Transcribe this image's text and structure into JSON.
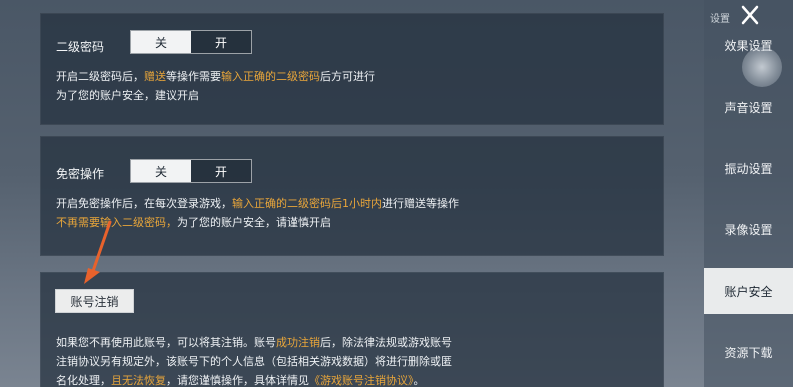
{
  "sidebar": {
    "header": "设置",
    "items": [
      {
        "label": "效果设置"
      },
      {
        "label": "声音设置"
      },
      {
        "label": "振动设置"
      },
      {
        "label": "录像设置"
      },
      {
        "label": "账户安全",
        "active": true
      },
      {
        "label": "资源下载"
      }
    ]
  },
  "secondary_password": {
    "label": "二级密码",
    "toggle": {
      "off": "关",
      "on": "开",
      "selected": "关"
    },
    "desc": {
      "l1_a": "开启二级密码后，",
      "l1_b": "赠送",
      "l1_c": "等操作需要",
      "l1_d": "输入正确的二级密码",
      "l1_e": "后方可进行",
      "l2": "为了您的账户安全，建议开启"
    }
  },
  "password_free": {
    "label": "免密操作",
    "toggle": {
      "off": "关",
      "on": "开",
      "selected": "关"
    },
    "desc": {
      "l1_a": "开启免密操作后，在每次登录游戏，",
      "l1_b": "输入正确的二级密码后1小时内",
      "l1_c": "进行赠送等操作",
      "l2_a": "不再需要输入二级密码，",
      "l2_b": "为了您的账户安全，请谨慎开启"
    }
  },
  "account_cancel": {
    "button": "账号注销",
    "desc": {
      "l1_a": "如果您不再使用此账号，可以将其注销。账号",
      "l1_b": "成功注销",
      "l1_c": "后，除法律法规或游戏账号",
      "l2": "注销协议另有规定外，该账号下的个人信息（包括相关游戏数据）将进行删除或匿",
      "l3_a": "名化处理，",
      "l3_b": "且无法恢复",
      "l3_c": "，请您谨慎操作，具体详情见",
      "l3_d": "《游戏账号注销协议》",
      "l3_e": "。"
    }
  },
  "colors": {
    "highlight": "#e9a63a",
    "arrow": "#e8622c"
  }
}
